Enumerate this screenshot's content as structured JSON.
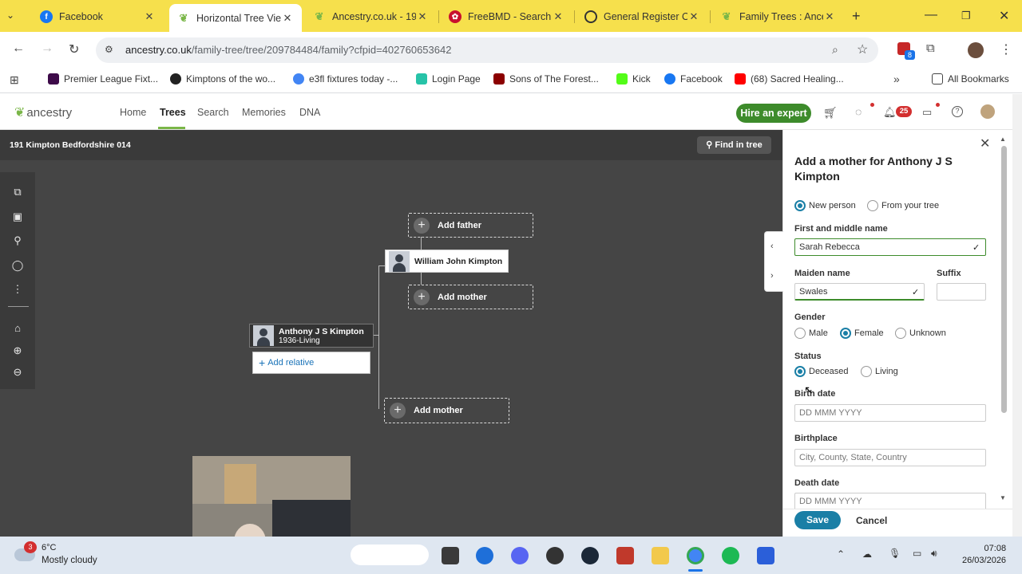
{
  "browser": {
    "tabs": [
      {
        "title": "Facebook",
        "icon": "facebook-icon",
        "color": "#1877f2",
        "active": false
      },
      {
        "title": "Horizontal Tree Vie",
        "icon": "ancestry-leaf-icon",
        "color": "#7ab648",
        "active": true
      },
      {
        "title": "Ancestry.co.uk - 19",
        "icon": "ancestry-leaf-icon",
        "color": "#7ab648",
        "active": false
      },
      {
        "title": "FreeBMD - Search",
        "icon": "freebmd-icon",
        "color": "#c8102e",
        "active": false
      },
      {
        "title": "General Register O",
        "icon": "globe-icon",
        "color": "#333333",
        "active": false
      },
      {
        "title": "Family Trees : Ance",
        "icon": "ancestry-leaf-icon",
        "color": "#7ab648",
        "active": false
      }
    ],
    "url_host": "ancestry.co.uk",
    "url_path": "/family-tree/tree/209784484/family?cfpid=402760653642",
    "extension_badge": "8",
    "bookmarks": [
      {
        "label": "Premier League Fixt...",
        "color": "#3d0a49"
      },
      {
        "label": "Kimptons of the wo...",
        "color": "#222222"
      },
      {
        "label": "e3fl fixtures today -...",
        "color": "#4285f4"
      },
      {
        "label": "Login Page",
        "color": "#27c3a8"
      },
      {
        "label": "Sons of The Forest...",
        "color": "#8b0000"
      },
      {
        "label": "Kick",
        "color": "#53fc18"
      },
      {
        "label": "Facebook",
        "color": "#1877f2"
      },
      {
        "label": "(68) Sacred Healing...",
        "color": "#ff0000"
      }
    ],
    "all_bookmarks": "All Bookmarks"
  },
  "site": {
    "logo": "ancestry",
    "nav": [
      "Home",
      "Trees",
      "Search",
      "Memories",
      "DNA"
    ],
    "hire_button": "Hire an expert",
    "notification_count": "25"
  },
  "tree": {
    "name": "191 Kimpton Bedfordshire 014",
    "find_in_tree": "Find in tree",
    "add_father": "Add father",
    "add_mother": "Add mother",
    "father_name": "William John Kimpton",
    "focus_name": "Anthony J S Kimpton",
    "focus_dates": "1936-Living",
    "add_relative": "Add relative",
    "add_mother_lower": "Add mother"
  },
  "panel": {
    "title": "Add a mother for Anthony J S Kimpton",
    "source_options": [
      "New person",
      "From your tree"
    ],
    "first_middle_label": "First and middle name",
    "first_middle_value": "Sarah Rebecca",
    "maiden_label": "Maiden name",
    "maiden_value": "Swales",
    "suffix_label": "Suffix",
    "gender_label": "Gender",
    "gender_options": [
      "Male",
      "Female",
      "Unknown"
    ],
    "gender_selected": "Female",
    "status_label": "Status",
    "status_options": [
      "Deceased",
      "Living"
    ],
    "status_selected": "Deceased",
    "birth_date_label": "Birth date",
    "date_placeholder": "DD MMM YYYY",
    "birthplace_label": "Birthplace",
    "place_placeholder": "City, County, State, Country",
    "death_date_label": "Death date",
    "save": "Save",
    "cancel": "Cancel"
  },
  "taskbar": {
    "weather_temp": "6°C",
    "weather_desc": "Mostly cloudy",
    "weather_badge": "3",
    "time": "07:08",
    "date": "26/03/2026"
  }
}
